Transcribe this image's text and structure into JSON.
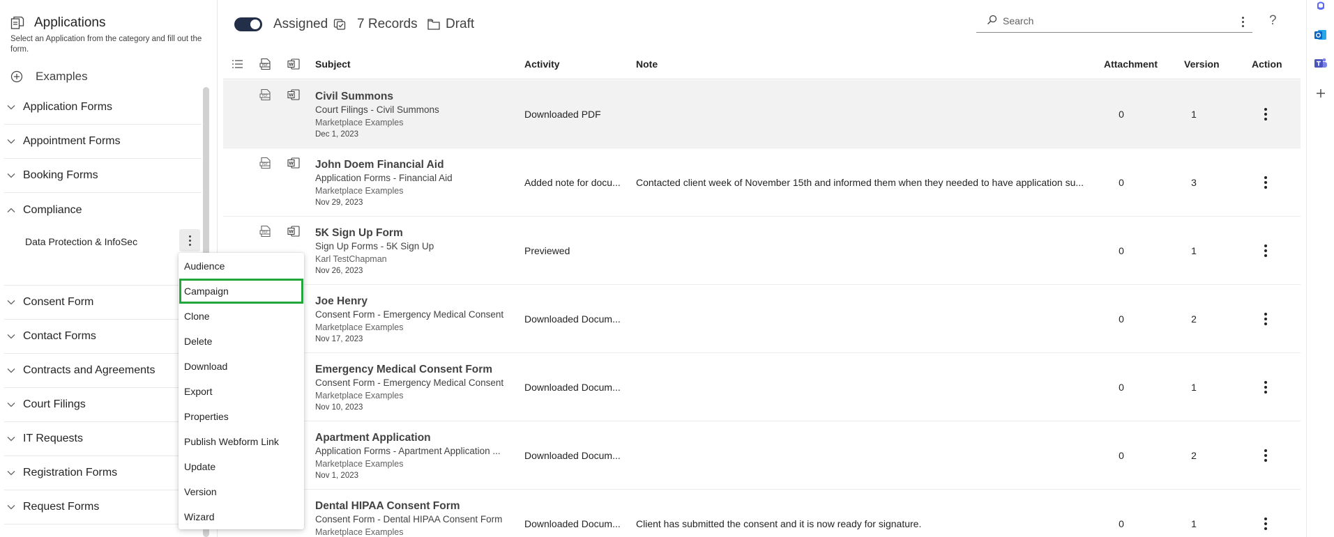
{
  "left_panel": {
    "title": "Applications",
    "description": "Select an Application from the category and fill out the form.",
    "examples_label": "Examples",
    "categories": [
      {
        "label": "Application Forms",
        "expanded": false
      },
      {
        "label": "Appointment Forms",
        "expanded": false
      },
      {
        "label": "Booking Forms",
        "expanded": false
      },
      {
        "label": "Compliance",
        "expanded": true
      },
      {
        "label": "Consent Form",
        "expanded": false
      },
      {
        "label": "Contact Forms",
        "expanded": false
      },
      {
        "label": "Contracts and Agreements",
        "expanded": false
      },
      {
        "label": "Court Filings",
        "expanded": false
      },
      {
        "label": "IT Requests",
        "expanded": false
      },
      {
        "label": "Registration Forms",
        "expanded": false
      },
      {
        "label": "Request Forms",
        "expanded": false
      }
    ],
    "subcategory": {
      "label": "Data Protection & InfoSec"
    }
  },
  "context_menu": {
    "items": [
      "Audience",
      "Campaign",
      "Clone",
      "Delete",
      "Download",
      "Export",
      "Properties",
      "Publish Webform Link",
      "Update",
      "Version",
      "Wizard"
    ],
    "highlighted": "Campaign"
  },
  "toolbar": {
    "assigned_label": "Assigned",
    "records_label": "7 Records",
    "draft_label": "Draft",
    "search_placeholder": "Search",
    "help_label": "?"
  },
  "table": {
    "headers": {
      "subject": "Subject",
      "activity": "Activity",
      "note": "Note",
      "attachment": "Attachment",
      "version": "Version",
      "action": "Action"
    },
    "rows": [
      {
        "title": "Civil Summons",
        "category": "Court Filings - Civil Summons",
        "by": "Marketplace Examples",
        "date": "Dec 1, 2023",
        "activity": "Downloaded PDF",
        "note": "",
        "attachment": "0",
        "version": "1",
        "selected": true
      },
      {
        "title": "John Doem Financial Aid",
        "category": "Application Forms - Financial Aid",
        "by": "Marketplace Examples",
        "date": "Nov 29, 2023",
        "activity": "Added note for docu...",
        "note": "Contacted client week of November 15th and informed them when they needed to have application su...",
        "attachment": "0",
        "version": "3",
        "selected": false
      },
      {
        "title": "5K Sign Up Form",
        "category": "Sign Up Forms - 5K Sign Up",
        "by": "Karl TestChapman",
        "date": "Nov 26, 2023",
        "activity": "Previewed",
        "note": "",
        "attachment": "0",
        "version": "1",
        "selected": false
      },
      {
        "title": "Joe Henry",
        "category": "Consent Form - Emergency Medical Consent",
        "by": "Marketplace Examples",
        "date": "Nov 17, 2023",
        "activity": "Downloaded Docum...",
        "note": "",
        "attachment": "0",
        "version": "2",
        "selected": false
      },
      {
        "title": "Emergency Medical Consent Form",
        "category": "Consent Form - Emergency Medical Consent",
        "by": "Marketplace Examples",
        "date": "Nov 10, 2023",
        "activity": "Downloaded Docum...",
        "note": "",
        "attachment": "0",
        "version": "1",
        "selected": false
      },
      {
        "title": "Apartment Application",
        "category": "Application Forms - Apartment Application ...",
        "by": "Marketplace Examples",
        "date": "Nov 1, 2023",
        "activity": "Downloaded Docum...",
        "note": "",
        "attachment": "0",
        "version": "2",
        "selected": false
      },
      {
        "title": "Dental HIPAA Consent Form",
        "category": "Consent Form - Dental HIPAA Consent Form",
        "by": "Marketplace Examples",
        "date": "",
        "activity": "Downloaded Docum...",
        "note": "Client has submitted the consent and it is now ready for signature.",
        "attachment": "0",
        "version": "1",
        "selected": false
      }
    ]
  },
  "icons": {
    "header": "applications-icon",
    "examples": "add-circle-icon",
    "row_icons": [
      "pdf-icon",
      "word-icon"
    ]
  },
  "colors": {
    "toggle_on": "#232f48",
    "menu_highlight": "#22a83a",
    "selected_row": "#f2f2f2"
  }
}
